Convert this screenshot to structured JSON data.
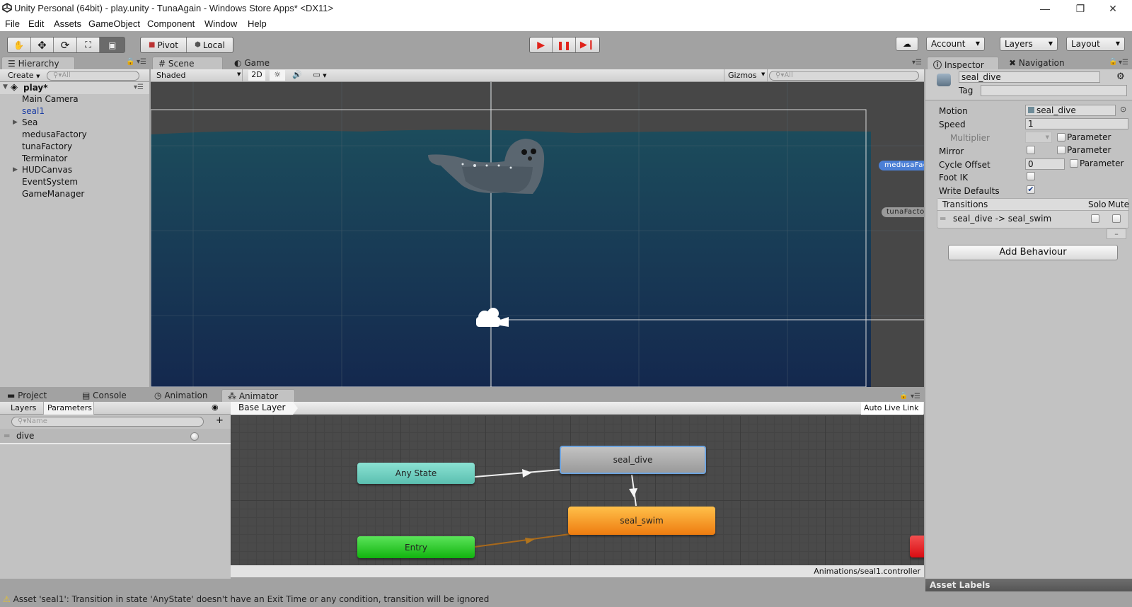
{
  "window": {
    "title": "Unity Personal (64bit) - play.unity - TunaAgain - Windows Store Apps* <DX11>",
    "minimize": "—",
    "maximize": "❐",
    "close": "✕"
  },
  "menu": [
    "File",
    "Edit",
    "Assets",
    "GameObject",
    "Component",
    "Window",
    "Help"
  ],
  "toolbar": {
    "tools": [
      "hand-tool",
      "move-tool",
      "rotate-tool",
      "scale-tool",
      "rect-tool"
    ],
    "pivot": "Pivot",
    "local": "Local",
    "account": "Account",
    "layers": "Layers",
    "layout": "Layout"
  },
  "hierarchy": {
    "tab": "Hierarchy",
    "create": "Create",
    "search_placeholder": "All",
    "scene": "play*",
    "items": [
      {
        "label": "Main Camera",
        "expandable": false,
        "selected": false
      },
      {
        "label": "seal1",
        "expandable": false,
        "selected": true
      },
      {
        "label": "Sea",
        "expandable": true,
        "selected": false
      },
      {
        "label": "medusaFactory",
        "expandable": false,
        "selected": false
      },
      {
        "label": "tunaFactory",
        "expandable": false,
        "selected": false
      },
      {
        "label": "Terminator",
        "expandable": false,
        "selected": false
      },
      {
        "label": "HUDCanvas",
        "expandable": true,
        "selected": false
      },
      {
        "label": "EventSystem",
        "expandable": false,
        "selected": false
      },
      {
        "label": "GameManager",
        "expandable": false,
        "selected": false
      }
    ]
  },
  "scene": {
    "tabs": [
      "Scene",
      "Game"
    ],
    "shading": "Shaded",
    "mode2d": "2D",
    "gizmos": "Gizmos",
    "search_placeholder": "All",
    "labels": {
      "medusa": "medusaFac",
      "tuna": "tunaFacto"
    }
  },
  "inspector": {
    "tabs": [
      "Inspector",
      "Navigation"
    ],
    "name": "seal_dive",
    "tag_label": "Tag",
    "tag_value": "",
    "fields": {
      "motion_label": "Motion",
      "motion_value": "seal_dive",
      "speed_label": "Speed",
      "speed_value": "1",
      "multiplier_label": "Multiplier",
      "mirror_label": "Mirror",
      "mirror_checked": false,
      "cycle_label": "Cycle Offset",
      "cycle_value": "0",
      "footik_label": "Foot IK",
      "footik_checked": false,
      "write_label": "Write Defaults",
      "write_checked": true,
      "parameter": "Parameter"
    },
    "transitions": {
      "header": "Transitions",
      "solo": "Solo",
      "mute": "Mute",
      "rows": [
        {
          "label": "seal_dive -> seal_swim",
          "solo": false,
          "mute": false
        }
      ],
      "remove": "–"
    },
    "add_behaviour": "Add Behaviour",
    "asset_labels": "Asset Labels"
  },
  "bottom_tabs": [
    "Project",
    "Console",
    "Animation",
    "Animator"
  ],
  "animator": {
    "subtabs": [
      "Layers",
      "Parameters"
    ],
    "search_placeholder": "Name",
    "parameters": [
      {
        "name": "dive",
        "type": "trigger"
      }
    ],
    "breadcrumb": "Base Layer",
    "auto_live_link": "Auto Live Link",
    "path": "Animations/seal1.controller",
    "states": [
      {
        "name": "Any State",
        "kind": "any",
        "color": "#6fcfbf"
      },
      {
        "name": "seal_dive",
        "kind": "selected",
        "color": "#a9a9a9"
      },
      {
        "name": "seal_swim",
        "kind": "default",
        "color": "#f39019"
      },
      {
        "name": "Entry",
        "kind": "entry",
        "color": "#22c11f"
      },
      {
        "name": "",
        "kind": "exit",
        "color": "#e0141a"
      }
    ],
    "transitions": [
      {
        "from": "Any State",
        "to": "seal_dive"
      },
      {
        "from": "seal_dive",
        "to": "seal_swim"
      },
      {
        "from": "Entry",
        "to": "seal_swim",
        "default": true
      }
    ]
  },
  "status": {
    "message": "Asset 'seal1': Transition in state 'AnyState' doesn't have an Exit Time or any condition, transition will be ignored"
  }
}
